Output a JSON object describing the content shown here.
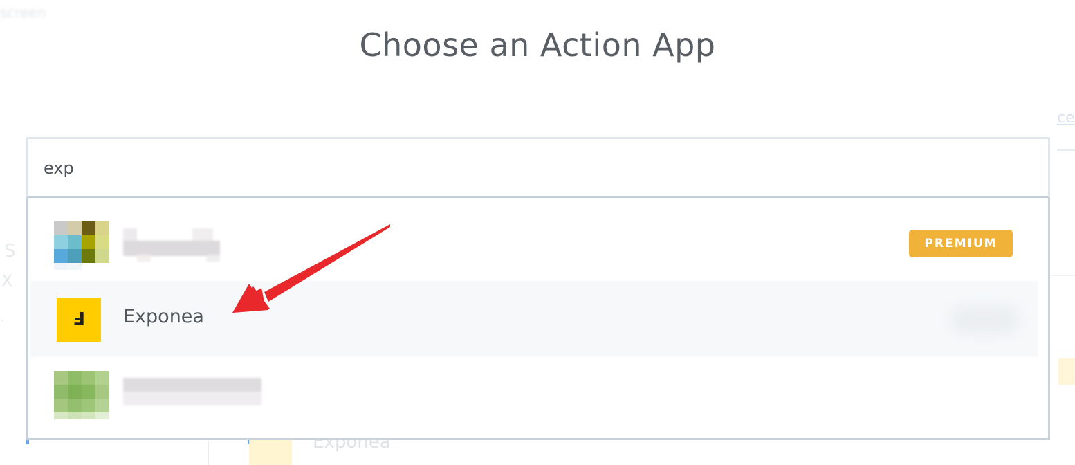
{
  "page": {
    "title": "Choose an Action App"
  },
  "search": {
    "value": "exp"
  },
  "results": [
    {
      "name": "",
      "badge": "PREMIUM",
      "blurred": true
    },
    {
      "name": "Exponea",
      "icon_glyph": "Ⅎ",
      "badge": "",
      "blurred": false
    },
    {
      "name": "",
      "badge": "",
      "blurred": true
    }
  ],
  "colors": {
    "premium_badge": "#f1b23a",
    "exponea_icon_bg": "#ffcc00",
    "highlight_row": "#f6f8fa",
    "annotation_arrow": "#e8282a"
  },
  "annotation": {
    "type": "arrow",
    "target": "Exponea"
  }
}
